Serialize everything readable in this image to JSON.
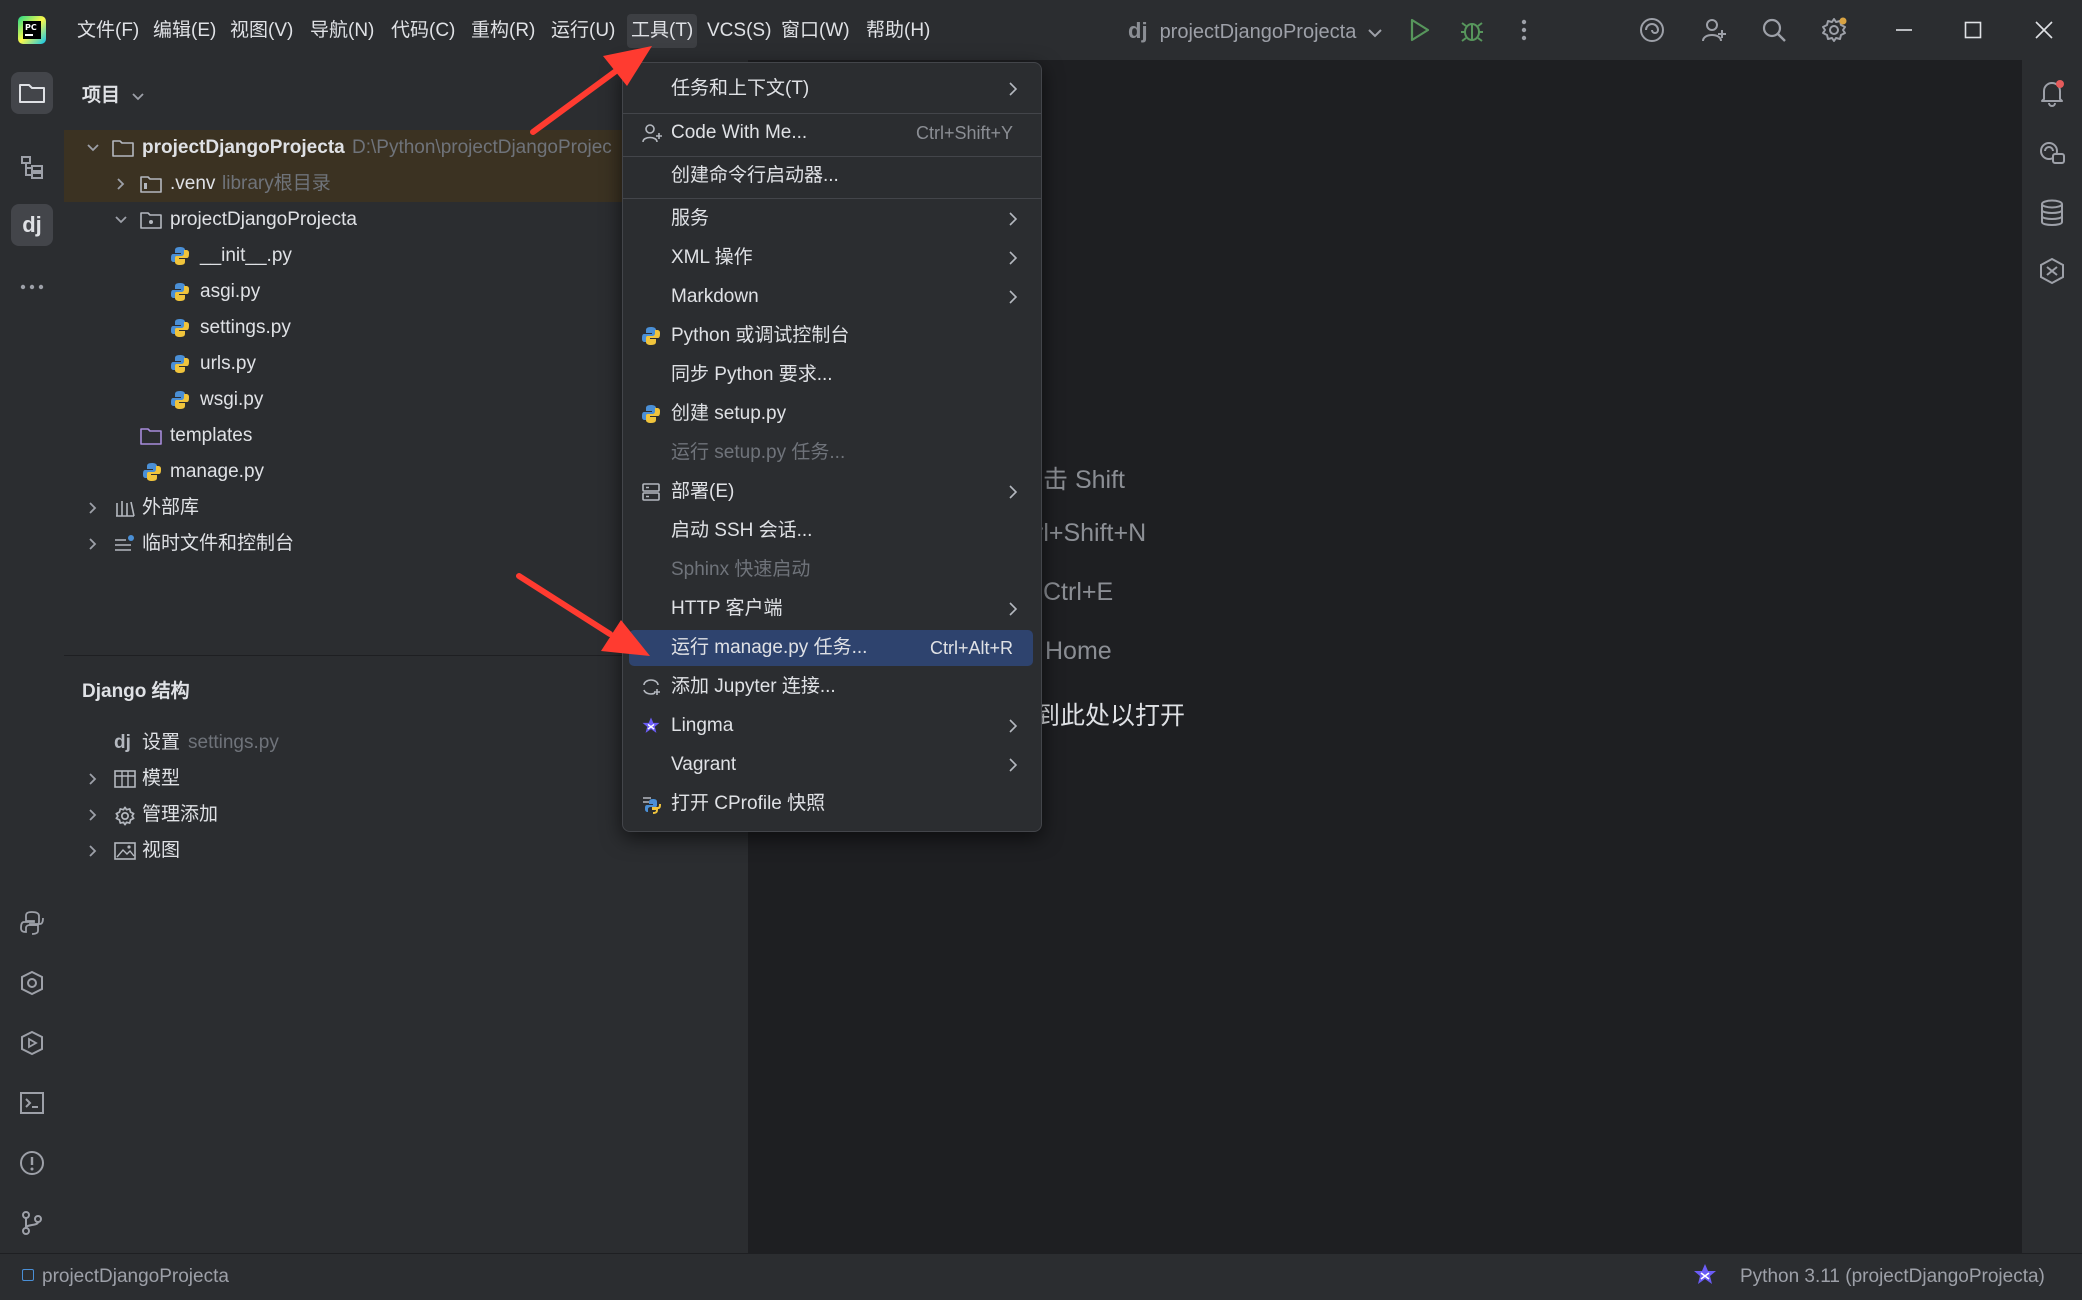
{
  "menubar": {
    "items": [
      {
        "label": "文件(F)"
      },
      {
        "label": "编辑(E)"
      },
      {
        "label": "视图(V)"
      },
      {
        "label": "导航(N)"
      },
      {
        "label": "代码(C)"
      },
      {
        "label": "重构(R)"
      },
      {
        "label": "运行(U)"
      },
      {
        "label": "工具(T)"
      },
      {
        "label": "VCS(S)"
      },
      {
        "label": "窗口(W)"
      },
      {
        "label": "帮助(H)"
      }
    ],
    "project_badge": "dj",
    "project_name": "projectDjangoProjecta"
  },
  "project_panel": {
    "title": "项目",
    "tree": [
      {
        "label": "projectDjangoProjecta",
        "hint": "D:\\Python\\projectDjangoProjec"
      },
      {
        "label": ".venv",
        "hint": "library根目录"
      },
      {
        "label": "projectDjangoProjecta",
        "hint": ""
      },
      {
        "label": "__init__.py",
        "hint": ""
      },
      {
        "label": "asgi.py",
        "hint": ""
      },
      {
        "label": "settings.py",
        "hint": ""
      },
      {
        "label": "urls.py",
        "hint": ""
      },
      {
        "label": "wsgi.py",
        "hint": ""
      },
      {
        "label": "templates",
        "hint": ""
      },
      {
        "label": "manage.py",
        "hint": ""
      },
      {
        "label": "外部库",
        "hint": ""
      },
      {
        "label": "临时文件和控制台",
        "hint": ""
      }
    ]
  },
  "django_panel": {
    "title": "Django 结构",
    "items": [
      {
        "badge": "dj",
        "label": "设置",
        "hint": "settings.py"
      },
      {
        "label": "模型"
      },
      {
        "label": "管理添加"
      },
      {
        "label": "视图"
      }
    ]
  },
  "editor_hints": [
    "击 Shift",
    "rl+Shift+N",
    "Ctrl+E",
    "Home",
    "到此处以打开"
  ],
  "dropdown": {
    "items": [
      {
        "label": "任务和上下文(T)",
        "shortcut": ""
      },
      {
        "label": "Code With Me...",
        "shortcut": "Ctrl+Shift+Y"
      },
      {
        "label": "创建命令行启动器...",
        "shortcut": ""
      },
      {
        "label": "服务",
        "shortcut": ""
      },
      {
        "label": "XML 操作",
        "shortcut": ""
      },
      {
        "label": "Markdown",
        "shortcut": ""
      },
      {
        "label": "Python 或调试控制台",
        "shortcut": ""
      },
      {
        "label": "同步 Python 要求...",
        "shortcut": ""
      },
      {
        "label": "创建 setup.py",
        "shortcut": ""
      },
      {
        "label": "运行 setup.py 任务...",
        "shortcut": ""
      },
      {
        "label": "部署(E)",
        "shortcut": ""
      },
      {
        "label": "启动 SSH 会话...",
        "shortcut": ""
      },
      {
        "label": "Sphinx 快速启动",
        "shortcut": ""
      },
      {
        "label": "HTTP 客户端",
        "shortcut": ""
      },
      {
        "label": "运行 manage.py 任务...",
        "shortcut": "Ctrl+Alt+R"
      },
      {
        "label": "添加 Jupyter 连接...",
        "shortcut": ""
      },
      {
        "label": "Lingma",
        "shortcut": ""
      },
      {
        "label": "Vagrant",
        "shortcut": ""
      },
      {
        "label": "打开 CProfile 快照",
        "shortcut": ""
      }
    ]
  },
  "statusbar": {
    "project": "projectDjangoProjecta",
    "interpreter": "Python 3.11 (projectDjangoProjecta)"
  },
  "colors": {
    "background": "#1e1f22",
    "panel": "#2b2d30",
    "highlight": "#2e436e",
    "arrow": "#ff3b30",
    "python_blue": "#4a8fd6",
    "python_yellow": "#f0c43c"
  }
}
